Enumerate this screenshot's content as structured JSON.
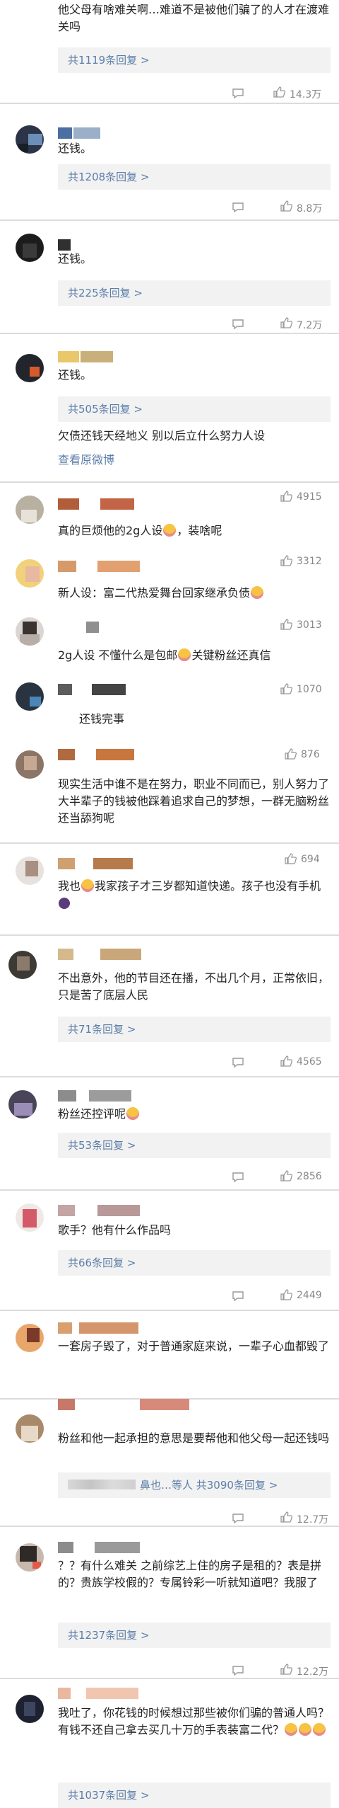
{
  "threads": [
    {
      "text": "他父母有啥难关啊…难道不是被他们骗了的人才在渡难关吗",
      "replies_label": "共1119条回复 >",
      "likes": "14.3万"
    },
    {
      "text": "还钱。",
      "replies_label": "共1208条回复 >",
      "likes": "8.8万"
    },
    {
      "text": "还钱。",
      "replies_label": "共225条回复 >",
      "likes": "7.2万"
    },
    {
      "text": "还钱。",
      "replies_label": "共505条回复 >",
      "extra_text": "欠债还钱天经地义 别以后立什么努力人设",
      "view_weibo": "查看原微博"
    },
    {
      "text": "真的巨烦他的2g人设",
      "text_tail": "，装啥呢",
      "likes": "4915"
    },
    {
      "text": "新人设：富二代热爱舞台回家继承负债",
      "likes": "3312"
    },
    {
      "text": "2g人设 不懂什么是包邮",
      "text_tail": "关键粉丝还真信",
      "likes": "3013"
    },
    {
      "text": "还钱完事",
      "likes": "1070"
    },
    {
      "text": "现实生活中谁不是在努力，职业不同而已，别人努力了大半辈子的钱被他踩着追求自己的梦想，一群无脑粉丝还当舔狗呢",
      "likes": "876"
    },
    {
      "text": "我也",
      "text_tail": "我家孩子才三岁都知道快递。孩子也没有手机",
      "likes": "694"
    },
    {
      "text": "不出意外，他的节目还在播，不出几个月，正常依旧，只是苦了底层人民",
      "replies_label": "共71条回复 >",
      "likes": "4565"
    },
    {
      "text": "粉丝还控评呢",
      "replies_label": "共53条回复 >",
      "likes": "2856"
    },
    {
      "text": "歌手？他有什么作品吗",
      "replies_label": "共66条回复 >",
      "likes": "2449"
    },
    {
      "text": "一套房子毁了，对于普通家庭来说，一辈子心血都毁了",
      "likes": ""
    },
    {
      "text": "粉丝和他一起承担的意思是要帮他和他父母一起还钱吗",
      "replies_label": "鼻也…等人 共3090条回复 >",
      "likes": "12.7万"
    },
    {
      "text": "？？有什么难关 之前综艺上住的房子是租的？表是拼的？贵族学校假的？专属铃彩一听就知道吧？我服了",
      "replies_label": "共1237条回复 >",
      "likes": "12.2万"
    },
    {
      "text": "我吐了，你花钱的时候想过那些被你们骗的普通人吗？有钱不还自己拿去买几十万的手表装富二代？",
      "replies_label": "共1037条回复 >"
    }
  ],
  "colors": {
    "link": "#5b7ea8",
    "text": "#222222",
    "meta": "#888888",
    "reply_bg": "#f2f2f2"
  }
}
